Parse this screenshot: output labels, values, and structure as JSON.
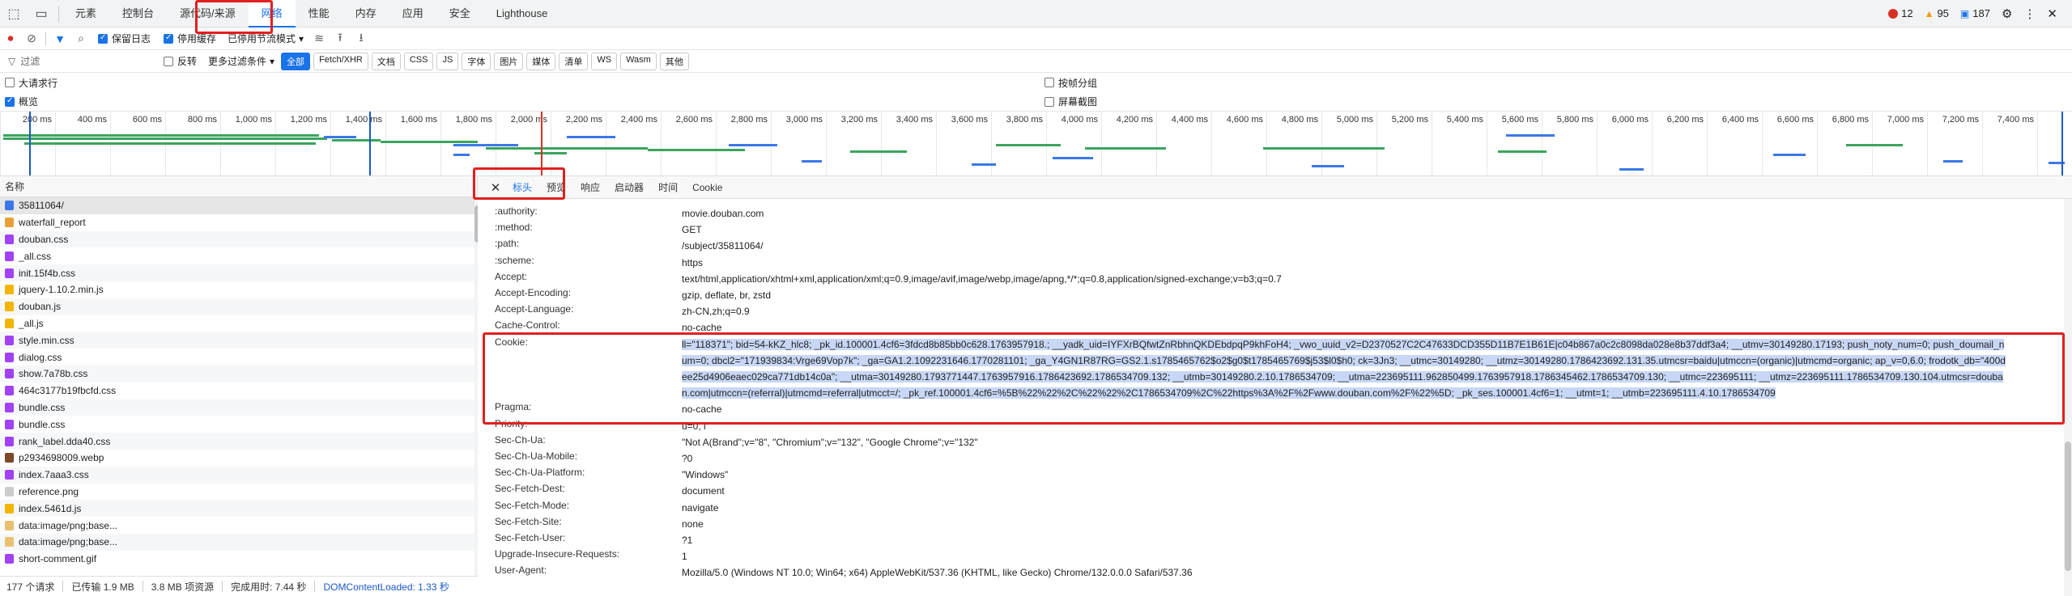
{
  "tabbar": {
    "tabs": [
      "元素",
      "控制台",
      "源代码/来源",
      "网络",
      "性能",
      "内存",
      "应用",
      "安全",
      "Lighthouse"
    ],
    "active_tab": "网络",
    "errors": "12",
    "warnings": "95",
    "issues": "187"
  },
  "toolbar": {
    "preserve_log": "保留日志",
    "disable_cache": "停用缓存",
    "throttle": "已停用节流模式"
  },
  "filterbar": {
    "placeholder": "过滤",
    "invert": "反转",
    "more_filters": "更多过滤条件",
    "chips": [
      "全部",
      "Fetch/XHR",
      "文档",
      "CSS",
      "JS",
      "字体",
      "图片",
      "媒体",
      "清单",
      "WS",
      "Wasm",
      "其他"
    ]
  },
  "options": {
    "large_rows": "大请求行",
    "overview": "概览",
    "group_by_frame": "按帧分组",
    "screenshots": "屏幕截图"
  },
  "timeline": {
    "ticks": [
      "200 ms",
      "400 ms",
      "600 ms",
      "800 ms",
      "1,000 ms",
      "1,200 ms",
      "1,400 ms",
      "1,600 ms",
      "1,800 ms",
      "2,000 ms",
      "2,200 ms",
      "2,400 ms",
      "2,600 ms",
      "2,800 ms",
      "3,000 ms",
      "3,200 ms",
      "3,400 ms",
      "3,600 ms",
      "3,800 ms",
      "4,000 ms",
      "4,200 ms",
      "4,400 ms",
      "4,600 ms",
      "4,800 ms",
      "5,000 ms",
      "5,200 ms",
      "5,400 ms",
      "5,600 ms",
      "5,800 ms",
      "6,000 ms",
      "6,200 ms",
      "6,400 ms",
      "6,600 ms",
      "6,800 ms",
      "7,000 ms",
      "7,200 ms",
      "7,400 ms",
      "7,6"
    ]
  },
  "list": {
    "header": "名称",
    "items": [
      {
        "name": "35811064/",
        "type": "doc",
        "color": "#3b78e7"
      },
      {
        "name": "waterfall_report",
        "type": "xhr",
        "color": "#e8a13a"
      },
      {
        "name": "douban.css",
        "type": "css",
        "color": "#a142f4"
      },
      {
        "name": "_all.css",
        "type": "css",
        "color": "#a142f4"
      },
      {
        "name": "init.15f4b.css",
        "type": "css",
        "color": "#a142f4"
      },
      {
        "name": "jquery-1.10.2.min.js",
        "type": "js",
        "color": "#f2b600"
      },
      {
        "name": "douban.js",
        "type": "js",
        "color": "#f2b600"
      },
      {
        "name": "_all.js",
        "type": "js",
        "color": "#f2b600"
      },
      {
        "name": "style.min.css",
        "type": "css",
        "color": "#a142f4"
      },
      {
        "name": "dialog.css",
        "type": "css",
        "color": "#a142f4"
      },
      {
        "name": "show.7a78b.css",
        "type": "css",
        "color": "#a142f4"
      },
      {
        "name": "464c3177b19fbcfd.css",
        "type": "css",
        "color": "#a142f4"
      },
      {
        "name": "bundle.css",
        "type": "css",
        "color": "#a142f4"
      },
      {
        "name": "bundle.css",
        "type": "css",
        "color": "#a142f4"
      },
      {
        "name": "rank_label.dda40.css",
        "type": "css",
        "color": "#a142f4"
      },
      {
        "name": "p2934698009.webp",
        "type": "img",
        "color": "#7a4a2a"
      },
      {
        "name": "index.7aaa3.css",
        "type": "css",
        "color": "#a142f4"
      },
      {
        "name": "reference.png",
        "type": "img",
        "color": "#cccccc"
      },
      {
        "name": "index.5461d.js",
        "type": "js",
        "color": "#f2b600"
      },
      {
        "name": "data:image/png;base...",
        "type": "img",
        "color": "#e8c070"
      },
      {
        "name": "data:image/png;base...",
        "type": "img",
        "color": "#e8c070"
      },
      {
        "name": "short-comment.gif",
        "type": "img",
        "color": "#a142f4"
      }
    ]
  },
  "status": {
    "requests": "177 个请求",
    "transferred": "已传输 1.9 MB",
    "resources": "3.8 MB 项资源",
    "finish": "完成用时: 7.44 秒",
    "dcl": "DOMContentLoaded: 1.33 秒"
  },
  "detail": {
    "tabs": [
      "标头",
      "预览",
      "响应",
      "启动器",
      "时间",
      "Cookie"
    ],
    "active_tab": "标头",
    "headers": [
      {
        "key": ":authority:",
        "value": "movie.douban.com"
      },
      {
        "key": ":method:",
        "value": "GET"
      },
      {
        "key": ":path:",
        "value": "/subject/35811064/"
      },
      {
        "key": ":scheme:",
        "value": "https"
      },
      {
        "key": "Accept:",
        "value": "text/html,application/xhtml+xml,application/xml;q=0.9,image/avif,image/webp,image/apng,*/*;q=0.8,application/signed-exchange;v=b3;q=0.7"
      },
      {
        "key": "Accept-Encoding:",
        "value": "gzip, deflate, br, zstd"
      },
      {
        "key": "Accept-Language:",
        "value": "zh-CN,zh;q=0.9"
      },
      {
        "key": "Cache-Control:",
        "value": "no-cache"
      }
    ],
    "cookie": {
      "key": "Cookie:",
      "value": "ll=\"118371\"; bid=54-kKZ_hlc8; _pk_id.100001.4cf6=3fdcd8b85bb0c628.1763957918.; __yadk_uid=IYFXrBQfwtZnRbhnQKDEbdpqP9khFoH4; _vwo_uuid_v2=D2370527C2C47633DCD355D11B7E1B61E|c04b867a0c2c8098da028e8b37ddf3a4; __utmv=30149280.17193; push_noty_num=0; push_doumail_num=0; dbcl2=\"171939834:Vrge69Vop7k\"; _ga=GA1.2.1092231646.1770281101; _ga_Y4GN1R87RG=GS2.1.s1785465762$o2$g0$t1785465769$j53$l0$h0; ck=3Jn3; __utmc=30149280; __utmz=30149280.1786423692.131.35.utmcsr=baidu|utmccn=(organic)|utmcmd=organic; ap_v=0,6.0; frodotk_db=\"400dee25d4906eaec029ca771db14c0a\"; __utma=30149280.1793771447.1763957916.1786423692.1786534709.132; __utmb=30149280.2.10.1786534709; __utma=223695111.962850499.1763957918.1786345462.1786534709.130; __utmc=223695111; __utmz=223695111.1786534709.130.104.utmcsr=douban.com|utmccn=(referral)|utmcmd=referral|utmcct=/; _pk_ref.100001.4cf6=%5B%22%22%2C%22%22%2C1786534709%2C%22https%3A%2F%2Fwww.douban.com%2F%22%5D; _pk_ses.100001.4cf6=1; __utmt=1; __utmb=223695111.4.10.1786534709"
    },
    "headers2": [
      {
        "key": "Pragma:",
        "value": "no-cache"
      },
      {
        "key": "Priority:",
        "value": "u=0, i"
      },
      {
        "key": "Sec-Ch-Ua:",
        "value": "\"Not A(Brand\";v=\"8\", \"Chromium\";v=\"132\", \"Google Chrome\";v=\"132\""
      },
      {
        "key": "Sec-Ch-Ua-Mobile:",
        "value": "?0"
      },
      {
        "key": "Sec-Ch-Ua-Platform:",
        "value": "\"Windows\""
      },
      {
        "key": "Sec-Fetch-Dest:",
        "value": "document"
      },
      {
        "key": "Sec-Fetch-Mode:",
        "value": "navigate"
      },
      {
        "key": "Sec-Fetch-Site:",
        "value": "none"
      },
      {
        "key": "Sec-Fetch-User:",
        "value": "?1"
      },
      {
        "key": "Upgrade-Insecure-Requests:",
        "value": "1"
      },
      {
        "key": "User-Agent:",
        "value": "Mozilla/5.0 (Windows NT 10.0; Win64; x64) AppleWebKit/537.36 (KHTML, like Gecko) Chrome/132.0.0.0 Safari/537.36"
      }
    ]
  },
  "colors": {
    "accent": "#1a73e8",
    "highlight": "#e02020",
    "error": "#d93025",
    "warning": "#f29900",
    "issue": "#1a73e8"
  }
}
